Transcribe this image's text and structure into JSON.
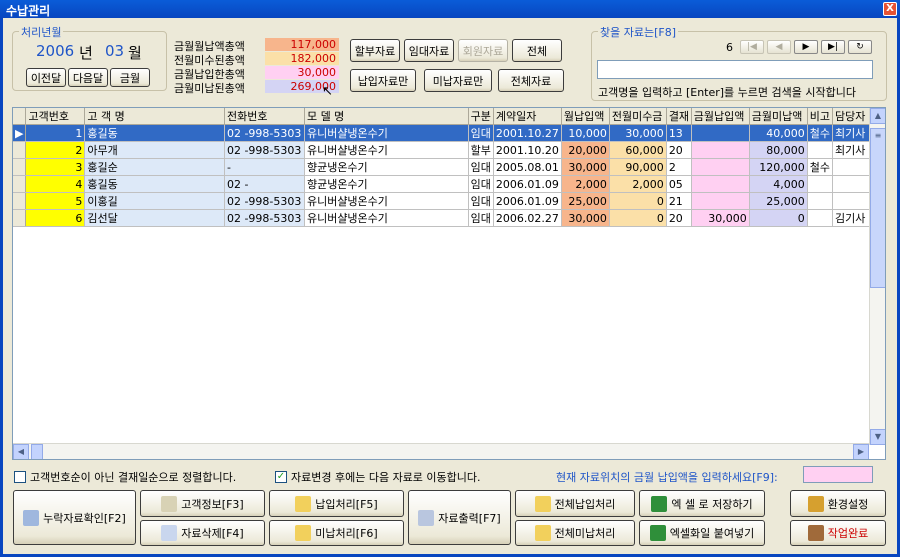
{
  "window": {
    "title": "수납관리",
    "close_label": "X"
  },
  "period": {
    "group_title": "처리년월",
    "year": "2006",
    "year_unit": "년",
    "month": "03",
    "month_unit": "월",
    "prev_label": "이전달",
    "next_label": "다음달",
    "current_label": "금월"
  },
  "summary": {
    "rows": [
      {
        "label": "금월월납액총액",
        "value": "117,000"
      },
      {
        "label": "전월미수된총액",
        "value": "182,000"
      },
      {
        "label": "금월납입한총액",
        "value": "30,000"
      },
      {
        "label": "금월미납된총액",
        "value": "269,000"
      }
    ],
    "colors": [
      "#f7b58c",
      "#fbe0a8",
      "#ffd0f2",
      "#d4d4f4"
    ]
  },
  "filters": {
    "installment": "할부자료",
    "rental": "임대자료",
    "member": "회원자료",
    "all": "전체",
    "paid_only": "납입자료만",
    "unpaid_only": "미납자료만",
    "all_data": "전체자료"
  },
  "search": {
    "group_title": "찾을 자료는[F8]",
    "count": "6",
    "input_value": "",
    "hint": "고객명을 입력하고 [Enter]를 누르면 검색을 시작합니다",
    "nav": [
      "|◀",
      "◀",
      "▶",
      "▶|",
      "↻"
    ]
  },
  "table": {
    "columns": [
      "고객번호",
      "고 객 명",
      "전화번호",
      "모 델 명",
      "구분",
      "계약일자",
      "월납입액",
      "전월미수금",
      "결재",
      "금월납입액",
      "금월미납액",
      "비고",
      "담당자"
    ],
    "rows": [
      [
        "1",
        "홍길동",
        "02 -998-5303",
        "유니버샬냉온수기",
        "임대",
        "2001.10.27",
        "10,000",
        "30,000",
        "13",
        "",
        "40,000",
        "철수",
        "최기사"
      ],
      [
        "2",
        "아무개",
        "02 -998-5303",
        "유니버샬냉온수기",
        "할부",
        "2001.10.20",
        "20,000",
        "60,000",
        "20",
        "",
        "80,000",
        "",
        "최기사"
      ],
      [
        "3",
        "홍길순",
        "-",
        "향균냉온수기",
        "임대",
        "2005.08.01",
        "30,000",
        "90,000",
        "2",
        "",
        "120,000",
        "철수",
        ""
      ],
      [
        "4",
        "홍길동",
        "02 -",
        "향균냉온수기",
        "임대",
        "2006.01.09",
        "2,000",
        "2,000",
        "05",
        "",
        "4,000",
        "",
        ""
      ],
      [
        "5",
        "이홍길",
        "02 -998-5303",
        "유니버샬냉온수기",
        "임대",
        "2006.01.09",
        "25,000",
        "0",
        "21",
        "",
        "25,000",
        "",
        ""
      ],
      [
        "6",
        "김선달",
        "02 -998-5303",
        "유니버샬냉온수기",
        "임대",
        "2006.02.27",
        "30,000",
        "0",
        "20",
        "30,000",
        "0",
        "",
        "김기사"
      ]
    ]
  },
  "options": {
    "sort_by_payment_day": "고객번호순이 아닌 결재일순으로 정렬합니다.",
    "move_next_after_change": "자료변경 후에는 다음 자료로 이동합니다.",
    "input_prompt": "현재 자료위치의 금월 납입액을 입력하세요[F9]:",
    "input_value": ""
  },
  "buttons": {
    "missing_check": "누락자료확인[F2]",
    "customer_info": "고객정보[F3]",
    "delete_data": "자료삭제[F4]",
    "pay_process": "납입처리[F5]",
    "unpaid_process": "미납처리[F6]",
    "print": "자료출력[F7]",
    "all_pay": "전체납입처리",
    "all_unpaid": "전체미납처리",
    "save_excel": "엑 셀 로 저장하기",
    "paste_excel": "엑셀화일 붙여넣기",
    "settings": "환경설정",
    "finish": "작업완료"
  }
}
